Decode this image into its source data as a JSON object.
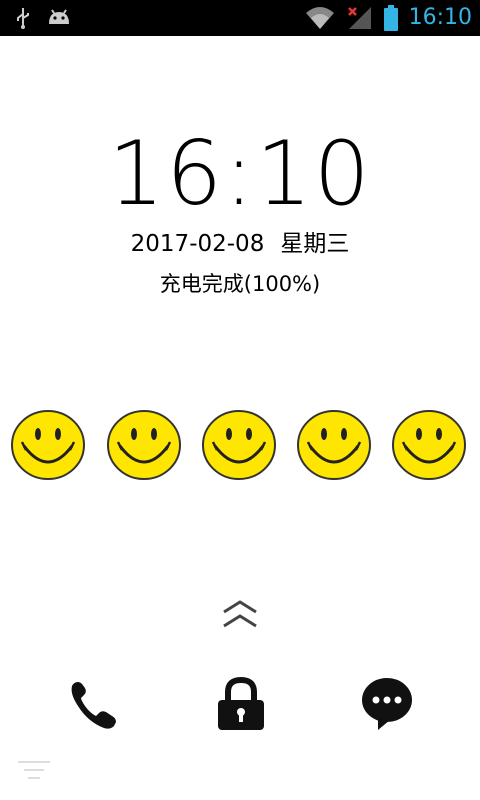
{
  "status_bar": {
    "time": "16:10",
    "icons": [
      "usb-icon",
      "android-debug-icon",
      "wifi-icon",
      "signal-icon",
      "battery-icon"
    ]
  },
  "lockscreen": {
    "clock": "16:10",
    "date": "2017-02-08",
    "weekday": "星期三",
    "charge_status": "充电完成(100%)"
  },
  "smileys": {
    "count": 5,
    "face_color": "#ffe600",
    "outline_color": "#333333"
  },
  "bottom_actions": {
    "icons": [
      "phone-icon",
      "lock-icon",
      "message-icon"
    ]
  },
  "colors": {
    "status_accent": "#33b5e5"
  }
}
